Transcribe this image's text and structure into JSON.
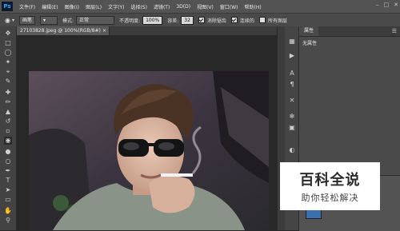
{
  "app": {
    "logo": "Ps"
  },
  "menu": [
    "文件(F)",
    "编辑(E)",
    "图像(I)",
    "图层(L)",
    "文字(Y)",
    "选择(S)",
    "滤镜(T)",
    "3D(D)",
    "视图(V)",
    "窗口(W)",
    "帮助(H)"
  ],
  "window_controls": {
    "minimize": "–",
    "maximize": "□",
    "close": "✕"
  },
  "options": {
    "brush_preset": "画笔",
    "mode_label": "模式:",
    "mode_value": "正常",
    "opacity_label": "不透明度:",
    "opacity_value": "100%",
    "flow_label": "容差:",
    "flow_value": "32",
    "antialias_label": "消除锯齿",
    "contiguous_label": "连续的",
    "all_layers_label": "所有图层"
  },
  "document": {
    "tab_title": "27103828.jpeg @ 100%(RGB/8#)",
    "close": "×"
  },
  "panel": {
    "tab": "属性",
    "content": "无属性"
  },
  "watermark": {
    "title": "百科全说",
    "subtitle": "助你轻松解决"
  },
  "icons": [
    "move-icon",
    "marquee-icon",
    "lasso-icon",
    "quick-select-icon",
    "crop-icon",
    "eyedropper-icon",
    "healing-icon",
    "brush-icon",
    "clone-stamp-icon",
    "history-brush-icon",
    "eraser-icon",
    "paint-bucket-icon",
    "blur-icon",
    "dodge-icon",
    "pen-icon",
    "type-icon",
    "path-select-icon",
    "shape-icon",
    "hand-icon",
    "zoom-icon"
  ]
}
